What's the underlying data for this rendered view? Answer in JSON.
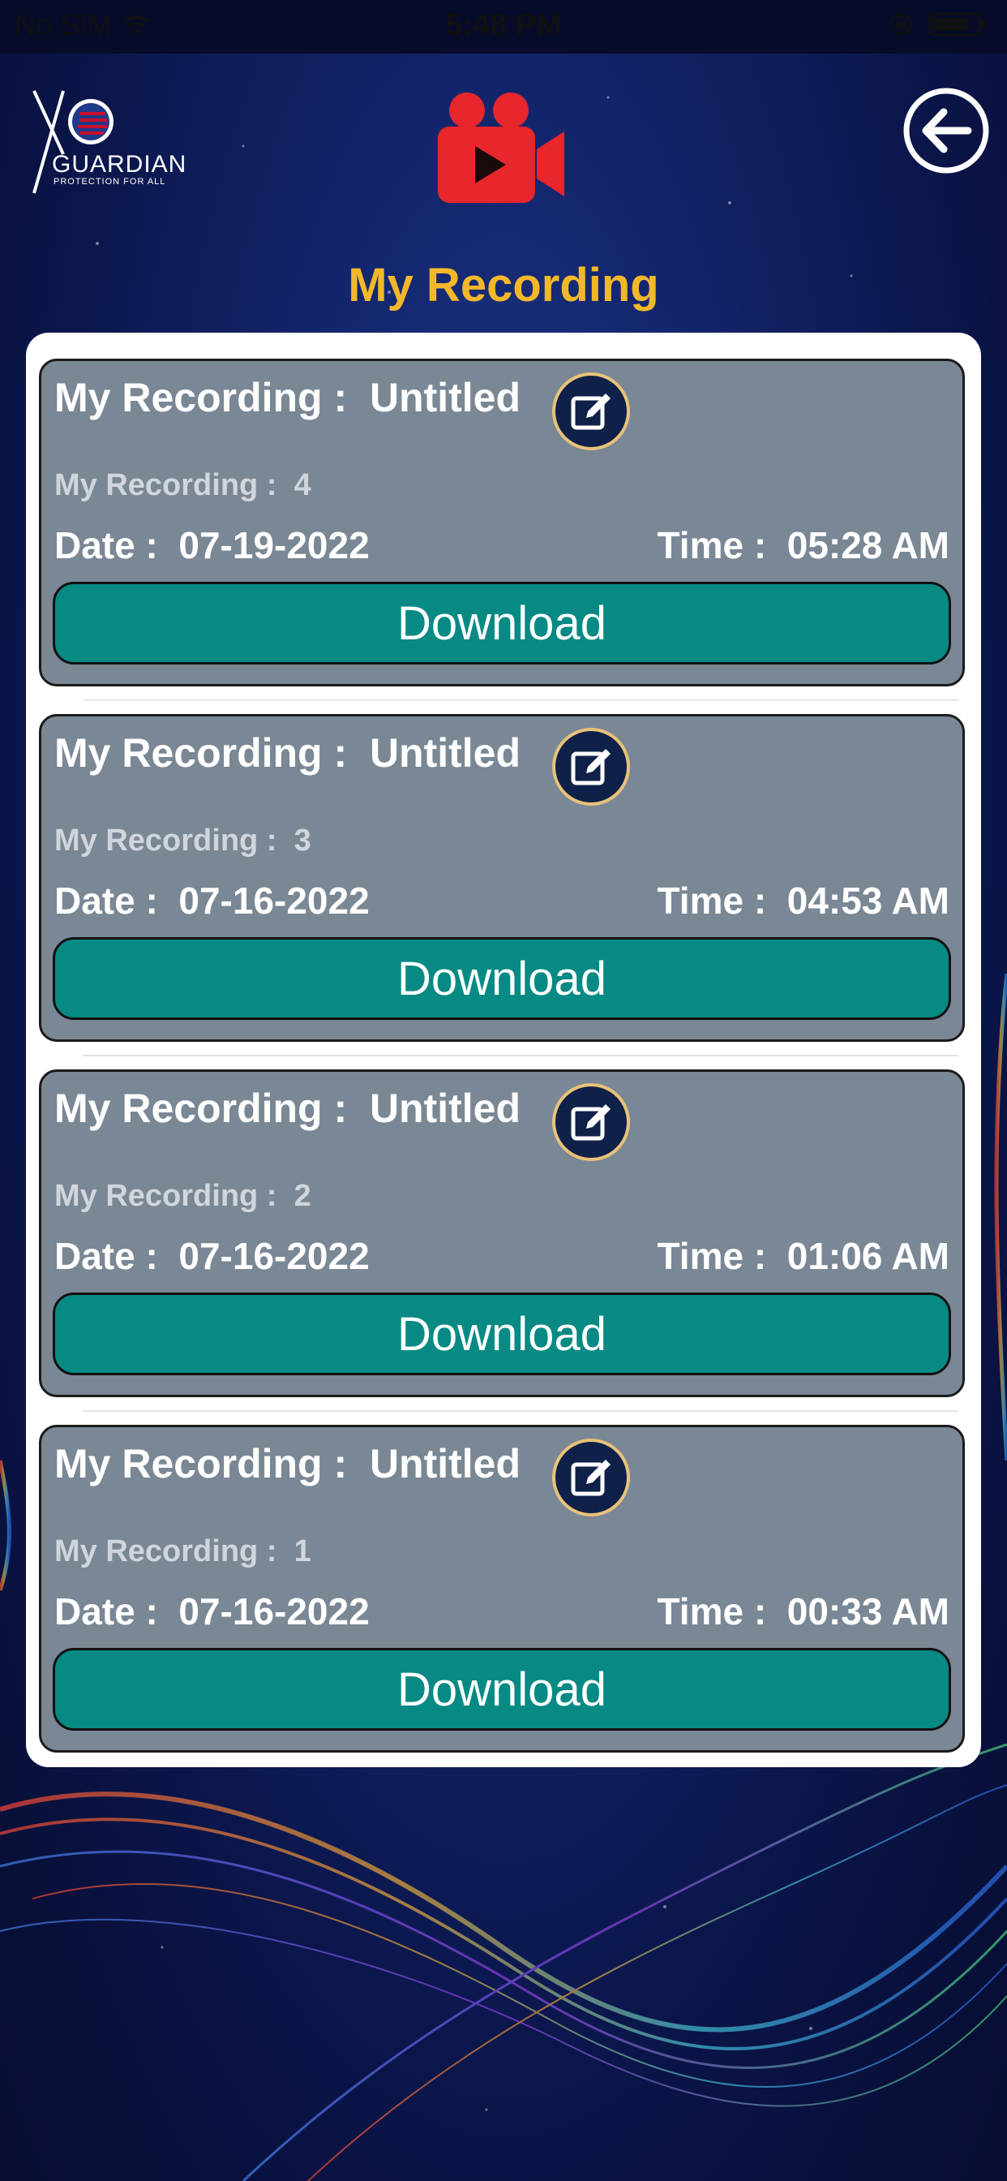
{
  "status_bar": {
    "carrier": "No SIM",
    "time": "5:48 PM"
  },
  "header": {
    "logo_text": "GUARDIAN",
    "logo_tagline": "PROTECTION FOR ALL",
    "title": "My Recording"
  },
  "colors": {
    "title": "#f3b82a",
    "card_bg": "#7a8795",
    "download_bg": "#078a84",
    "camera_icon": "#e8262b",
    "edit_icon_bg": "#0f2148"
  },
  "icons": {
    "camera": "video-camera-icon",
    "back": "arrow-left-circle-icon",
    "edit": "edit-square-icon"
  },
  "recordings": [
    {
      "title_label": "My Recording :",
      "title_value": "Untitled",
      "sub_label": "My Recording :",
      "sub_value": "4",
      "date_label": "Date :",
      "date_value": "07-19-2022",
      "time_label": "Time :",
      "time_value": "05:28 AM",
      "download_label": "Download"
    },
    {
      "title_label": "My Recording :",
      "title_value": "Untitled",
      "sub_label": "My Recording :",
      "sub_value": "3",
      "date_label": "Date :",
      "date_value": "07-16-2022",
      "time_label": "Time :",
      "time_value": "04:53 AM",
      "download_label": "Download"
    },
    {
      "title_label": "My Recording :",
      "title_value": "Untitled",
      "sub_label": "My Recording :",
      "sub_value": "2",
      "date_label": "Date :",
      "date_value": "07-16-2022",
      "time_label": "Time :",
      "time_value": "01:06 AM",
      "download_label": "Download"
    },
    {
      "title_label": "My Recording :",
      "title_value": "Untitled",
      "sub_label": "My Recording :",
      "sub_value": "1",
      "date_label": "Date :",
      "date_value": "07-16-2022",
      "time_label": "Time :",
      "time_value": "00:33 AM",
      "download_label": "Download"
    }
  ]
}
